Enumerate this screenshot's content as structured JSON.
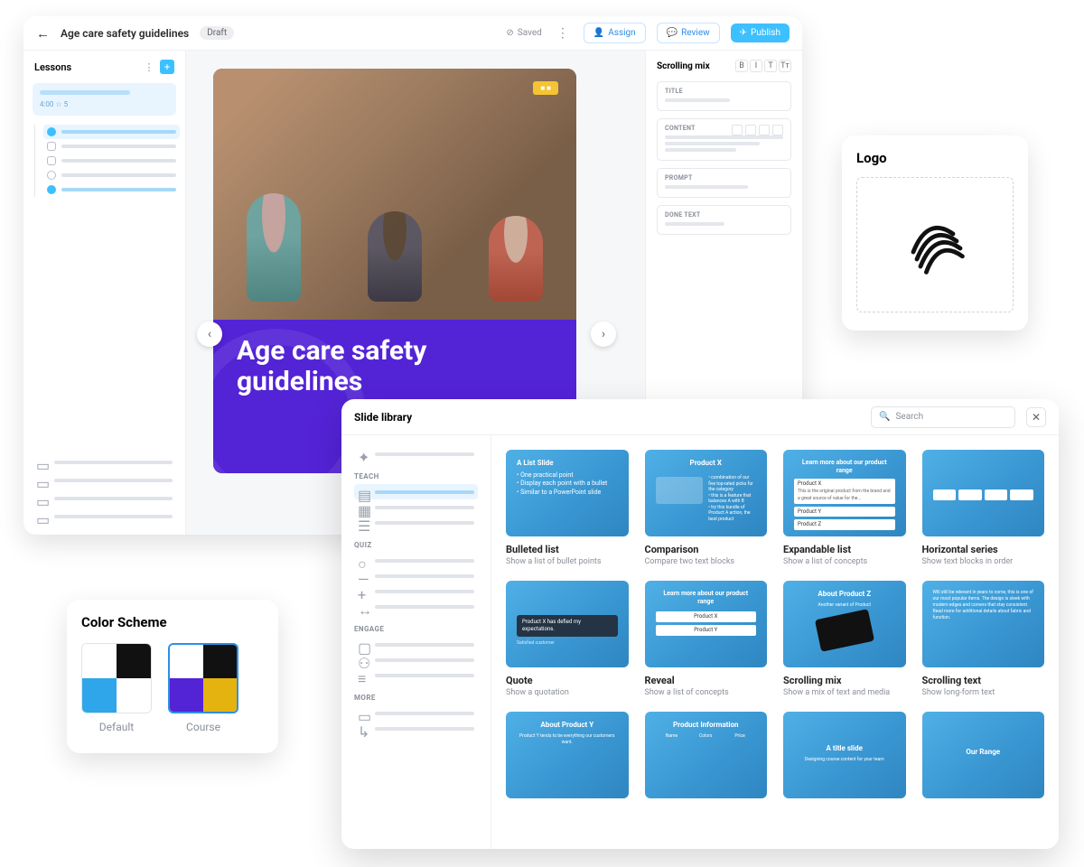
{
  "editor": {
    "doc_title": "Age care safety guidelines",
    "draft_label": "Draft",
    "saved_label": "Saved",
    "assign_label": "Assign",
    "review_label": "Review",
    "publish_label": "Publish",
    "sidebar": {
      "heading": "Lessons",
      "lesson_meta": "4:00  ☆ 5"
    },
    "slide": {
      "title": "Age care safety guidelines"
    },
    "inspector": {
      "heading": "Scrolling mix",
      "fields": {
        "title": "TITLE",
        "content": "CONTENT",
        "prompt": "PROMPT",
        "done": "DONE TEXT"
      }
    }
  },
  "logo_card": {
    "heading": "Logo"
  },
  "color_scheme": {
    "heading": "Color Scheme",
    "options": [
      {
        "label": "Default",
        "colors": [
          "#ffffff",
          "#111111",
          "#2fa6e9",
          "#ffffff"
        ],
        "selected": false
      },
      {
        "label": "Course",
        "colors": [
          "#ffffff",
          "#111111",
          "#5323d6",
          "#e5b310"
        ],
        "selected": true
      }
    ]
  },
  "library": {
    "title": "Slide library",
    "search_placeholder": "Search",
    "categories": [
      "TEACH",
      "QUIZ",
      "ENGAGE",
      "MORE"
    ],
    "tiles": [
      {
        "name": "Bulleted list",
        "desc": "Show a list of bullet points",
        "thumb_title": "A List Slide"
      },
      {
        "name": "Comparison",
        "desc": "Compare two text blocks",
        "thumb_title": "Product X"
      },
      {
        "name": "Expandable list",
        "desc": "Show a list of concepts",
        "thumb_title": "Learn more about our product range"
      },
      {
        "name": "Horizontal series",
        "desc": "Show text blocks in order",
        "thumb_title": ""
      },
      {
        "name": "Quote",
        "desc": "Show a quotation",
        "thumb_title": "Product X has defied my expectations."
      },
      {
        "name": "Reveal",
        "desc": "Show a list of concepts",
        "thumb_title": "Learn more about our product range"
      },
      {
        "name": "Scrolling mix",
        "desc": "Show a mix of text and media",
        "thumb_title": "About Product Z"
      },
      {
        "name": "Scrolling text",
        "desc": "Show long-form text",
        "thumb_title": ""
      },
      {
        "name": "",
        "desc": "",
        "thumb_title": "About Product Y"
      },
      {
        "name": "",
        "desc": "",
        "thumb_title": "Product Information"
      },
      {
        "name": "",
        "desc": "",
        "thumb_title": "A title slide"
      },
      {
        "name": "",
        "desc": "",
        "thumb_title": "Our Range"
      }
    ]
  }
}
